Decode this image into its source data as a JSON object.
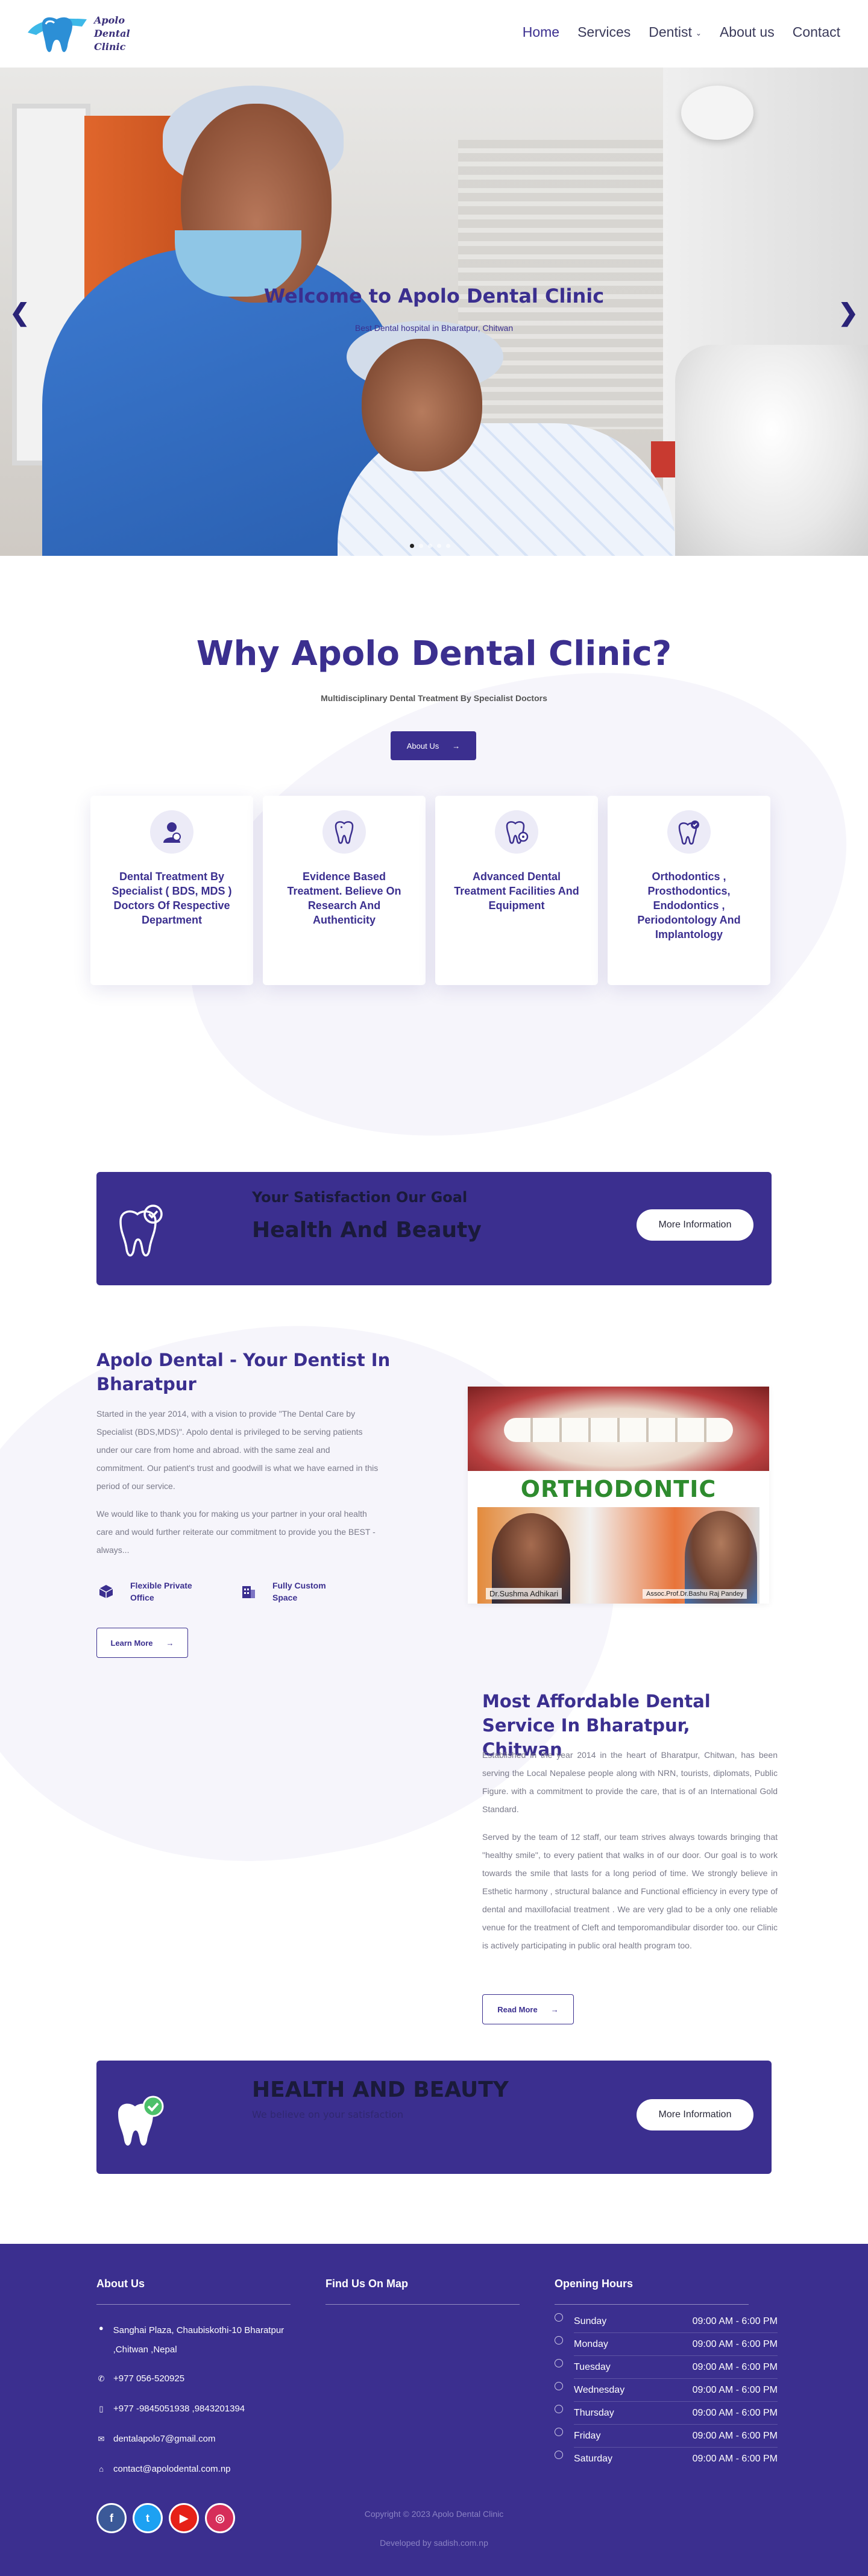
{
  "brand": {
    "name": "Apolo\nDental\nClinic"
  },
  "nav": {
    "items": [
      {
        "label": "Home",
        "active": true
      },
      {
        "label": "Services"
      },
      {
        "label": "Dentist",
        "dropdown": true
      },
      {
        "label": "About us"
      },
      {
        "label": "Contact"
      }
    ]
  },
  "hero": {
    "title": "Welcome to Apolo Dental Clinic",
    "subtitle": "Best Dental hospital in Bharatpur, Chitwan",
    "prev": "❮",
    "next": "❯",
    "slides": 5,
    "active_slide": 0
  },
  "why": {
    "title": "Why Apolo Dental Clinic?",
    "subtitle": "Multidisciplinary Dental Treatment By Specialist Doctors",
    "button": "About Us",
    "cards": [
      {
        "icon": "dentist-icon",
        "text": "Dental Treatment By Specialist ( BDS, MDS ) Doctors Of Respective Department"
      },
      {
        "icon": "tooth-sparkle-icon",
        "text": "Evidence Based Treatment. Believe On Research And Authenticity"
      },
      {
        "icon": "tooth-gear-icon",
        "text": "Advanced Dental Treatment Facilities And Equipment"
      },
      {
        "icon": "tooth-check-icon",
        "text": "Orthodontics , Prosthodontics, Endodontics , Periodontology And Implantology"
      }
    ]
  },
  "banner1": {
    "kicker": "Your Satisfaction Our Goal",
    "title": "Health And Beauty",
    "button": "More Information"
  },
  "about1": {
    "title": "Apolo Dental - Your Dentist In Bharatpur",
    "p1": "Started in the year 2014, with a vision to provide \"The  Dental Care by Specialist (BDS,MDS)\". Apolo dental is privileged to be serving patients under our care from home and abroad. with the same zeal and commitment. Our patient's trust and goodwill is what we have earned in this period of our service.",
    "p2": "We would like to thank you for making us your partner in your oral health care and would further reiterate our commitment to provide you the BEST - always...",
    "features": [
      {
        "icon": "cube-icon",
        "text": "Flexible Private Office"
      },
      {
        "icon": "building-icon",
        "text": "Fully Custom Space"
      }
    ],
    "button": "Learn More"
  },
  "ortho": {
    "heading": "ORTHODONTIC CENTER",
    "left_caption": "Dr.Sushma Adhikari",
    "right_caption": "Assoc.Prof.Dr.Bashu Raj Pandey"
  },
  "about2": {
    "title": "Most Affordable Dental Service In Bharatpur, Chitwan",
    "p1": "Established in the year 2014 in the heart of Bharatpur, Chitwan,  has been serving the Local Nepalese people along with NRN, tourists, diplomats, Public Figure. with a commitment to provide the care, that is of an International Gold Standard.",
    "p2": "Served by the team of 12 staff, our team strives always towards bringing that \"healthy smile\", to every patient that walks in of our door. Our goal is to work towards the smile that lasts for a long period of time. We strongly believe in  Esthetic harmony , structural balance and  Functional efficiency in every type of dental and maxillofacial treatment . We are very glad to be a only one  reliable venue  for the treatment of Cleft and temporomandibular disorder too. our Clinic is actively participating in public oral health program too.",
    "button": "Read More"
  },
  "banner2": {
    "title": "HEALTH AND BEAUTY",
    "kicker": "We believe on your satisfaction",
    "button": "More Information"
  },
  "footer": {
    "about_title": "About Us",
    "map_title": "Find Us On Map",
    "hours_title": "Opening Hours",
    "address": "Sanghai Plaza, Chaubiskothi-10 Bharatpur ,Chitwan ,Nepal",
    "phone": "+977 056-520925",
    "mobile": "+977 -9845051938 ,9843201394",
    "email": "dentalapolo7@gmail.com",
    "contact_email": "contact@apolodental.com.np",
    "hours": [
      {
        "day": "Sunday",
        "time": "09:00 AM - 6:00 PM"
      },
      {
        "day": "Monday",
        "time": "09:00 AM - 6:00 PM"
      },
      {
        "day": "Tuesday",
        "time": "09:00 AM - 6:00 PM"
      },
      {
        "day": "Wednesday",
        "time": "09:00 AM - 6:00 PM"
      },
      {
        "day": "Thursday",
        "time": "09:00 AM - 6:00 PM"
      },
      {
        "day": "Friday",
        "time": "09:00 AM - 6:00 PM"
      },
      {
        "day": "Saturday",
        "time": "09:00 AM - 6:00 PM"
      }
    ],
    "socials": [
      {
        "name": "facebook-icon",
        "glyph": "f",
        "color": "#3b5998"
      },
      {
        "name": "twitter-icon",
        "glyph": "t",
        "color": "#1da1f2"
      },
      {
        "name": "youtube-icon",
        "glyph": "▶",
        "color": "#e62117"
      },
      {
        "name": "instagram-icon",
        "glyph": "◎",
        "color": "#d62e5a"
      }
    ],
    "copyright": "Copyright © 2023 Apolo Dental Clinic",
    "developer": "Developed by sadish.com.np"
  },
  "colors": {
    "primary": "#3b2f8f",
    "white": "#ffffff",
    "green": "#2e8b2e"
  }
}
